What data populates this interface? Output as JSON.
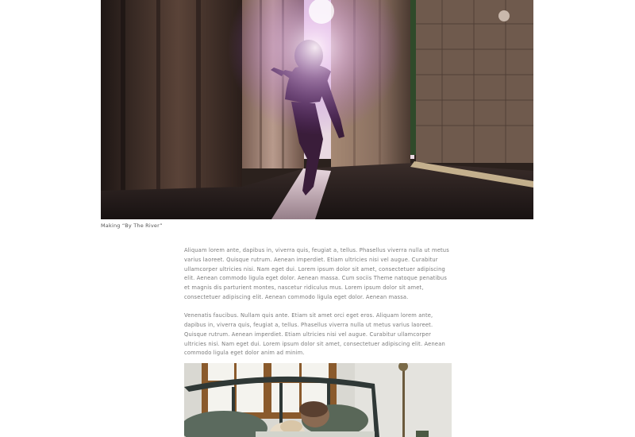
{
  "hero_image": {
    "alt": "Dancer between sunlit columns",
    "colors": {
      "shadow": "#2a1f1c",
      "stone": "#8a6f60",
      "light": "#f3e3ec",
      "flare": "#9b4fd0"
    }
  },
  "caption": "Making “By The River”",
  "article": {
    "paragraphs": [
      "Aliquam lorem ante, dapibus in, viverra quis, feugiat a, tellus. Phasellus viverra nulla ut metus varius laoreet. Quisque rutrum. Aenean imperdiet. Etiam ultricies nisi vel augue. Curabitur ullamcorper ultricies nisi. Nam eget dui. Lorem ipsum dolor sit amet, consectetuer adipiscing elit. Aenean commodo ligula eget dolor. Aenean massa. Cum sociis Theme natoque penatibus et magnis dis parturient montes, nascetur ridiculus mus. Lorem ipsum dolor sit amet, consectetuer adipiscing elit. Aenean commodo ligula eget dolor. Aenean massa.",
      "Venenatis faucibus. Nullam quis ante. Etiam sit amet orci eget eros. Aliquam lorem ante, dapibus in, viverra quis, feugiat a, tellus. Phasellus viverra nulla ut metus varius laoreet. Quisque rutrum. Aenean imperdiet. Etiam ultricies nisi vel augue. Curabitur ullamcorper ultricies nisi. Nam eget dui. Lorem ipsum dolor sit amet, consectetuer adipiscing elit. Aenean commodo ligula eget dolor anim ad minim."
    ]
  },
  "second_image": {
    "alt": "Couple resting on a bed by a window",
    "colors": {
      "wall": "#d9d8d2",
      "window_frame": "#8a5a2c",
      "headboard": "#2f3836",
      "pillow": "#5b6a5e"
    }
  }
}
